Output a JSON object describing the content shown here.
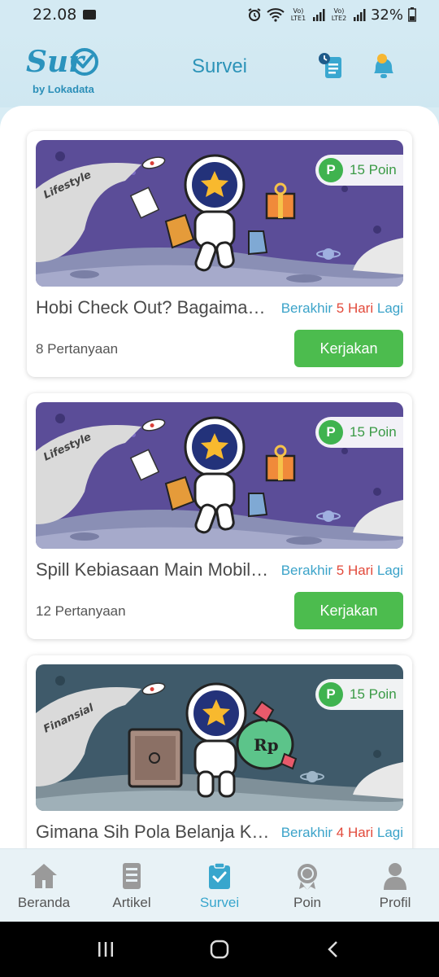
{
  "status_bar": {
    "time": "22.08",
    "battery": "32%",
    "sim1": "Vo) LTE1",
    "sim2": "Vo) LTE2"
  },
  "header": {
    "title": "Survei",
    "logo_text": "Surv",
    "logo_sub": "by Lokadata",
    "icons": [
      "survey-list-icon",
      "notification-bell-icon"
    ]
  },
  "surveys": [
    {
      "category": "Lifestyle",
      "title": "Hobi Check Out? Bagaimana Kebiasaanmu",
      "points": "15 Poin",
      "deadline_prefix": "Berakhir",
      "deadline_value": "5 Hari",
      "deadline_suffix": "Lagi",
      "questions": "8 Pertanyaan",
      "button": "Kerjakan"
    },
    {
      "category": "Lifestyle",
      "title": "Spill Kebiasaan Main Mobile Game",
      "points": "15 Poin",
      "deadline_prefix": "Berakhir",
      "deadline_value": "5 Hari",
      "deadline_suffix": "Lagi",
      "questions": "12 Pertanyaan",
      "button": "Kerjakan"
    },
    {
      "category": "Finansial",
      "title": "Gimana Sih Pola Belanja Kamu",
      "points": "15 Poin",
      "deadline_prefix": "Berakhir",
      "deadline_value": "4 Hari",
      "deadline_suffix": "Lagi",
      "questions": "",
      "button": "Kerjakan"
    }
  ],
  "bottom_nav": [
    {
      "label": "Beranda",
      "icon": "home-icon",
      "active": false
    },
    {
      "label": "Artikel",
      "icon": "article-icon",
      "active": false
    },
    {
      "label": "Survei",
      "icon": "survey-clipboard-icon",
      "active": true
    },
    {
      "label": "Poin",
      "icon": "medal-icon",
      "active": false
    },
    {
      "label": "Profil",
      "icon": "profile-icon",
      "active": false
    }
  ],
  "colors": {
    "accent": "#38a6cd",
    "button_green": "#4cbc4e",
    "deadline_red": "#e24a3b",
    "lifestyle_bg": "#5c4d9a",
    "finansial_bg": "#3f5a6a"
  }
}
